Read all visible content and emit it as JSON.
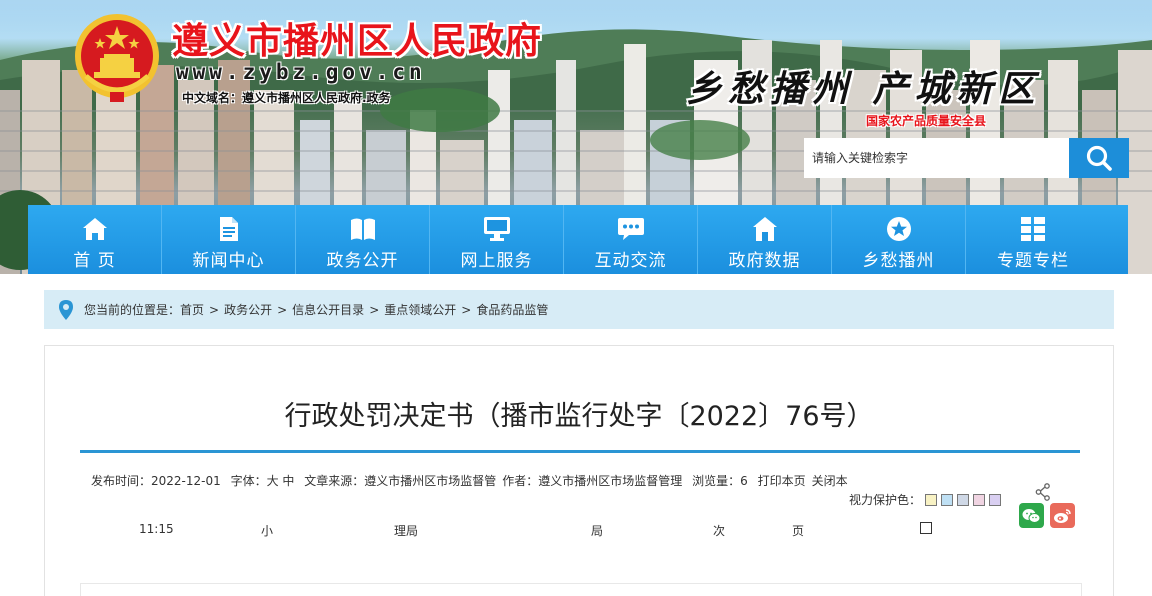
{
  "header": {
    "site_title": "遵义市播州区人民政府",
    "site_url": "www.zybz.gov.cn",
    "chinese_domain": "中文域名：遵义市播州区人民政府.政务",
    "slogan": "乡愁播州  产城新区",
    "slogan_sub": "国家农产品质量安全县",
    "search_placeholder": "请输入关键检索字",
    "brand_red": "#e8141b",
    "nav_blue": "#1b8fde"
  },
  "nav": {
    "items": [
      {
        "label": "首 页",
        "icon": "home-icon"
      },
      {
        "label": "新闻中心",
        "icon": "document-icon"
      },
      {
        "label": "政务公开",
        "icon": "book-icon"
      },
      {
        "label": "网上服务",
        "icon": "monitor-icon"
      },
      {
        "label": "互动交流",
        "icon": "chat-icon"
      },
      {
        "label": "政府数据",
        "icon": "building-icon"
      },
      {
        "label": "乡愁播州",
        "icon": "star-icon"
      },
      {
        "label": "专题专栏",
        "icon": "grid-icon"
      }
    ]
  },
  "breadcrumb": {
    "lead": "您当前的位置是：",
    "items": [
      "首页",
      "政务公开",
      "信息公开目录",
      "重点领域公开",
      "食品药品监管"
    ],
    "separator": ">"
  },
  "article": {
    "title": "行政处罚决定书（播市监行处字〔2022〕76号）",
    "meta": {
      "date_label": "发布时间：2022-12-01",
      "date_cont": "11:15",
      "font_label": "字体：大 中",
      "font_cont": "小",
      "source_label": "文章来源：遵义市播州区市场监督管",
      "source_cont": "理局",
      "author_label": "作者：遵义市播州区市场监督管理",
      "author_cont": "局",
      "views_label": "浏览量：6",
      "views_cont": "次",
      "print_label": "打印本页",
      "print_cont": "页",
      "close_label": "关闭本"
    },
    "vision_label": "视力保护色：",
    "swatches": [
      "#f8f2c4",
      "#bfe0f4",
      "#cfd8e6",
      "#f0d4e2",
      "#d9cff1",
      "#ffffff"
    ]
  }
}
